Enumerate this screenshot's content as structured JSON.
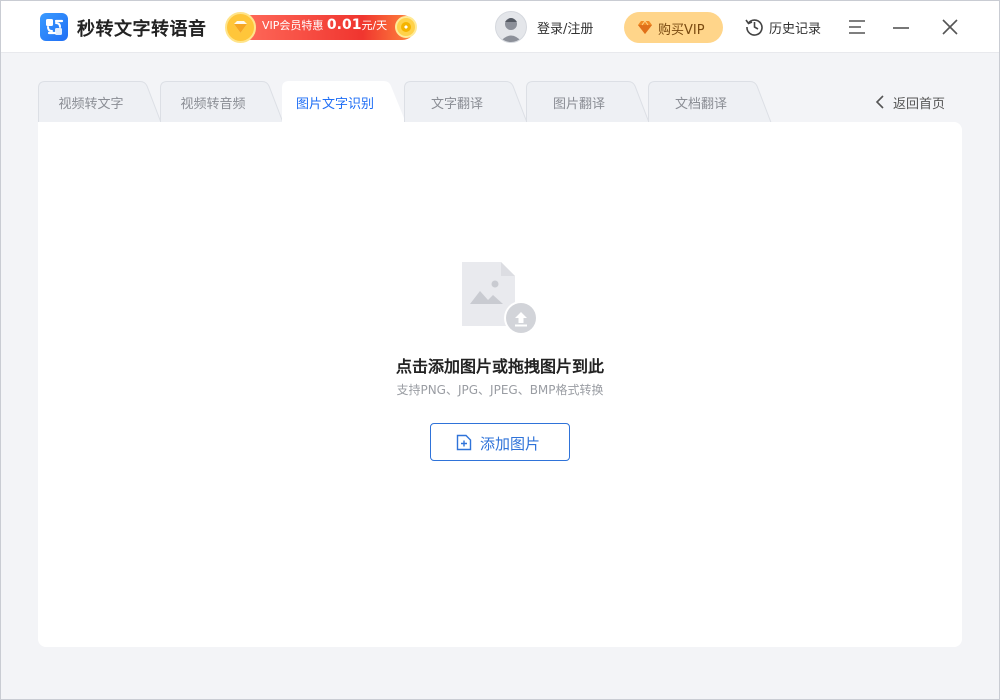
{
  "app": {
    "title": "秒转文字转语音"
  },
  "promo": {
    "prefix": "VIP会员特惠",
    "price": "0.01",
    "suffix": "元/天"
  },
  "header": {
    "login_label": "登录/注册",
    "buy_vip_label": "购买VIP",
    "history_label": "历史记录"
  },
  "tabs": [
    {
      "label": "视频转文字",
      "active": false
    },
    {
      "label": "视频转音频",
      "active": false
    },
    {
      "label": "图片文字识别",
      "active": true
    },
    {
      "label": "文字翻译",
      "active": false
    },
    {
      "label": "图片翻译",
      "active": false
    },
    {
      "label": "文档翻译",
      "active": false
    }
  ],
  "back_home_label": "返回首页",
  "upload": {
    "headline": "点击添加图片或拖拽图片到此",
    "formats": "支持PNG、JPG、JPEG、BMP格式转换",
    "button_label": "添加图片"
  },
  "colors": {
    "accent": "#1f6ef5",
    "button_border": "#2f73d9",
    "vip_gold": "#ffd58a",
    "promo_red": "#f0352f",
    "background": "#f3f4f7"
  }
}
